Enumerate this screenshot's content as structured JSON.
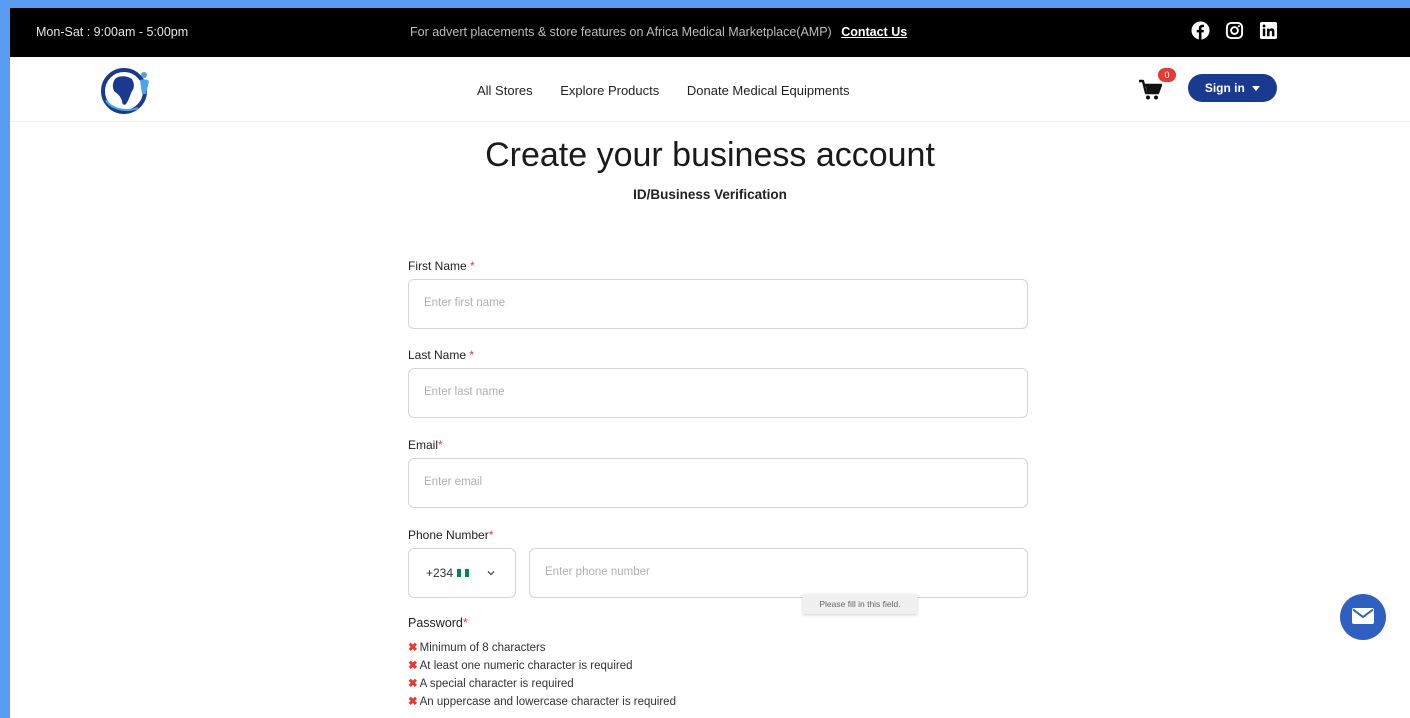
{
  "topbar": {
    "hours": "Mon-Sat : 9:00am - 5:00pm",
    "promo_text": "For advert placements & store features on Africa Medical Marketplace(AMP)",
    "contact_link": "Contact Us",
    "social_icons": [
      "facebook-icon",
      "instagram-icon",
      "linkedin-icon"
    ]
  },
  "nav": {
    "links": [
      "All Stores",
      "Explore Products",
      "Donate Medical Equipments"
    ],
    "cart_count": "0",
    "signin_label": "Sign in"
  },
  "page": {
    "title": "Create your business account",
    "subtitle": "ID/Business Verification"
  },
  "form": {
    "first_name": {
      "label": "First Name",
      "required_mark": "*",
      "placeholder": "Enter first name",
      "value": ""
    },
    "last_name": {
      "label": "Last Name",
      "required_mark": "*",
      "placeholder": "Enter last name",
      "value": ""
    },
    "email": {
      "label": "Email",
      "required_mark": "*",
      "placeholder": "Enter email",
      "value": ""
    },
    "phone": {
      "label": "Phone Number",
      "required_mark": "*",
      "country_code": "+234",
      "placeholder": "Enter phone number",
      "value": ""
    },
    "validation_tooltip": "Please fill in this field.",
    "password": {
      "label": "Password",
      "required_mark": "*",
      "rules": [
        "Minimum of 8 characters",
        "At least one numeric character is required",
        "A special character is required",
        "An uppercase and lowercase character is required"
      ]
    }
  },
  "colors": {
    "brand_blue": "#1a3a8f",
    "error_red": "#e53935",
    "border_blue": "#5a9cf3"
  }
}
